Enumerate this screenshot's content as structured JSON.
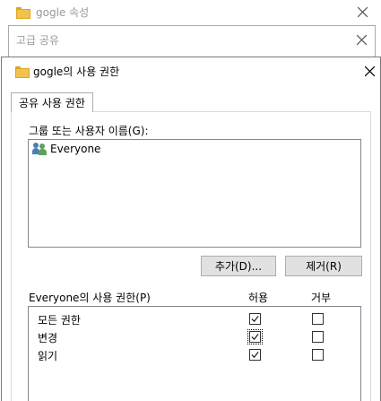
{
  "background_window": {
    "title": "gogle 속성"
  },
  "share_window": {
    "title": "고급 공유"
  },
  "dialog": {
    "title": "gogle의 사용 권한",
    "tab_label": "공유 사용 권한",
    "group_label": "그룹 또는 사용자 이름(G):",
    "users": [
      {
        "name": "Everyone",
        "icon": "users-icon"
      }
    ],
    "add_button": "추가(D)...",
    "remove_button": "제거(R)",
    "permissions_label": "Everyone의 사용 권한(P)",
    "allow_header": "허용",
    "deny_header": "거부",
    "permissions": [
      {
        "name": "모든 권한",
        "allow": true,
        "deny": false
      },
      {
        "name": "변경",
        "allow": true,
        "deny": false,
        "focused": true
      },
      {
        "name": "읽기",
        "allow": true,
        "deny": false
      }
    ]
  }
}
